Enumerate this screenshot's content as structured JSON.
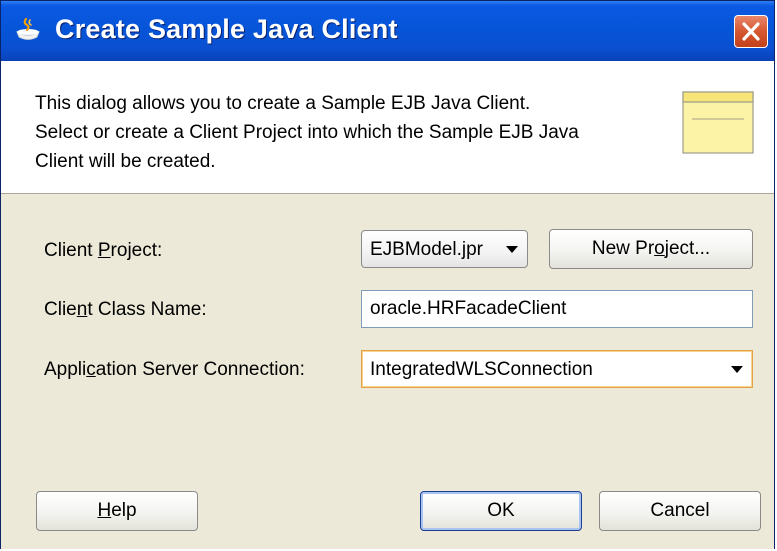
{
  "window": {
    "title": "Create Sample Java Client",
    "close_icon": "close-icon"
  },
  "banner": {
    "lines": [
      "This dialog allows you to create a Sample EJB Java Client.",
      "Select or create a Client Project into which the Sample EJB Java",
      "Client will be created."
    ],
    "icon": "note-icon"
  },
  "form": {
    "client_project": {
      "label_pre": "Client ",
      "label_mn": "P",
      "label_post": "roject:",
      "value": "EJBModel.jpr"
    },
    "new_project_button": {
      "pre": "New Pr",
      "mn": "o",
      "post": "ject..."
    },
    "client_class_name": {
      "label_pre": "Clie",
      "label_mn": "n",
      "label_post": "t Class Name:",
      "value": "oracle.HRFacadeClient"
    },
    "app_server_connection": {
      "label_pre": "Appli",
      "label_mn": "c",
      "label_post": "ation Server Connection:",
      "value": "IntegratedWLSConnection"
    }
  },
  "buttons": {
    "help": {
      "mn": "H",
      "post": "elp"
    },
    "ok": "OK",
    "cancel": "Cancel"
  },
  "colors": {
    "titlebar": "#0655d9",
    "dialog_bg": "#ece9d8",
    "close_button": "#d5572f",
    "focus_border": "#e7a04a"
  }
}
